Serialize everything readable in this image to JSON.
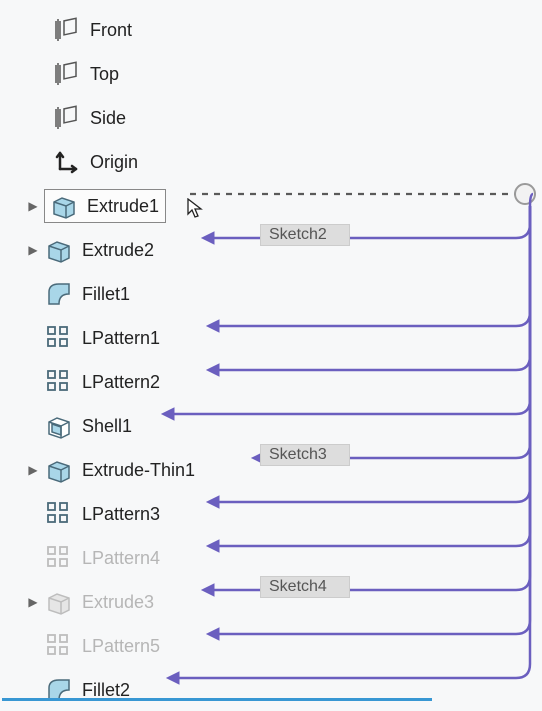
{
  "reference_planes": [
    {
      "label": "Front"
    },
    {
      "label": "Top"
    },
    {
      "label": "Side"
    }
  ],
  "origin": {
    "label": "Origin"
  },
  "features": [
    {
      "label": "Extrude1",
      "icon": "extrude",
      "dim": false,
      "expander": true,
      "selected": true,
      "sketchTag": null,
      "arrow": false
    },
    {
      "label": "Extrude2",
      "icon": "extrude",
      "dim": false,
      "expander": true,
      "selected": false,
      "sketchTag": "Sketch2",
      "arrow": true
    },
    {
      "label": "Fillet1",
      "icon": "fillet",
      "dim": false,
      "expander": false,
      "selected": false,
      "sketchTag": null,
      "arrow": false
    },
    {
      "label": "LPattern1",
      "icon": "pattern",
      "dim": false,
      "expander": false,
      "selected": false,
      "sketchTag": null,
      "arrow": true
    },
    {
      "label": "LPattern2",
      "icon": "pattern",
      "dim": false,
      "expander": false,
      "selected": false,
      "sketchTag": null,
      "arrow": true
    },
    {
      "label": "Shell1",
      "icon": "shell",
      "dim": false,
      "expander": false,
      "selected": false,
      "sketchTag": null,
      "arrow": true
    },
    {
      "label": "Extrude-Thin1",
      "icon": "extrude",
      "dim": false,
      "expander": true,
      "selected": false,
      "sketchTag": "Sketch3",
      "arrow": true
    },
    {
      "label": "LPattern3",
      "icon": "pattern",
      "dim": false,
      "expander": false,
      "selected": false,
      "sketchTag": null,
      "arrow": true
    },
    {
      "label": "LPattern4",
      "icon": "pattern",
      "dim": true,
      "expander": false,
      "selected": false,
      "sketchTag": null,
      "arrow": true
    },
    {
      "label": "Extrude3",
      "icon": "extrude",
      "dim": true,
      "expander": true,
      "selected": false,
      "sketchTag": "Sketch4",
      "arrow": true
    },
    {
      "label": "LPattern5",
      "icon": "pattern",
      "dim": true,
      "expander": false,
      "selected": false,
      "sketchTag": null,
      "arrow": true
    },
    {
      "label": "Fillet2",
      "icon": "fillet",
      "dim": false,
      "expander": false,
      "selected": false,
      "sketchTag": null,
      "arrow": true
    }
  ],
  "colors": {
    "arrow": "#6b5fbf",
    "node": "#c8c8c8",
    "dashed": "#5a5a5a"
  }
}
